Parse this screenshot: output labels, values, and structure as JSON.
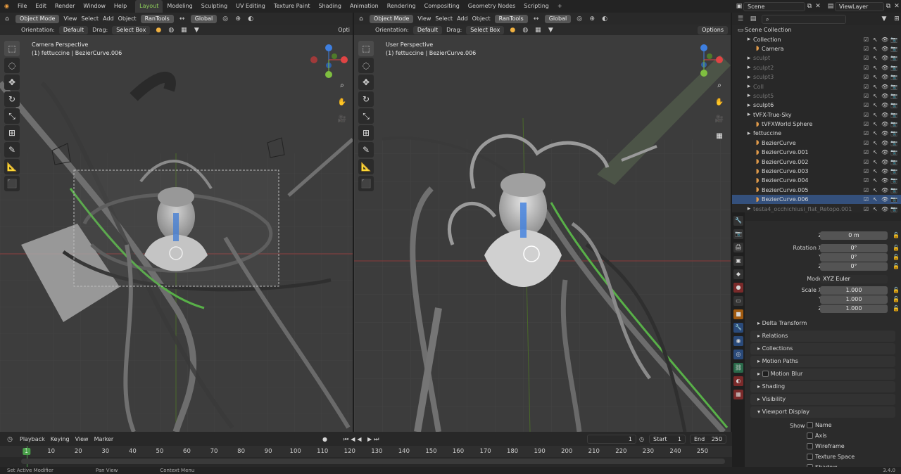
{
  "menu": [
    "File",
    "Edit",
    "Render",
    "Window",
    "Help"
  ],
  "workspaces": [
    {
      "label": "Layout",
      "active": true
    },
    {
      "label": "Modeling"
    },
    {
      "label": "Sculpting"
    },
    {
      "label": "UV Editing"
    },
    {
      "label": "Texture Paint"
    },
    {
      "label": "Shading"
    },
    {
      "label": "Animation"
    },
    {
      "label": "Rendering"
    },
    {
      "label": "Compositing"
    },
    {
      "label": "Geometry Nodes"
    },
    {
      "label": "Scripting"
    }
  ],
  "add_workspace": "+",
  "scene": "Scene",
  "view_layer": "ViewLayer",
  "left_view": {
    "mode": "Object Mode",
    "menus": [
      "View",
      "Select",
      "Add",
      "Object"
    ],
    "addon": "RanTools",
    "transform": "Global",
    "orientation_label": "Orientation:",
    "orientation": "Default",
    "drag_label": "Drag:",
    "drag": "Select Box",
    "options": "Opti",
    "perspective": "Camera Perspective",
    "object": "(1) fettuccine | BezierCurve.006"
  },
  "right_view": {
    "mode": "Object Mode",
    "menus": [
      "View",
      "Select",
      "Add",
      "Object"
    ],
    "addon": "RanTools",
    "transform": "Global",
    "orientation_label": "Orientation:",
    "orientation": "Default",
    "drag_label": "Drag:",
    "drag": "Select Box",
    "options": "Options",
    "perspective": "User Perspective",
    "object": "(1) fettuccine | BezierCurve.006"
  },
  "outliner": {
    "search_placeholder": "",
    "rows": [
      {
        "label": "Scene Collection",
        "indent": 0
      },
      {
        "label": "Collection",
        "indent": 1
      },
      {
        "label": "Camera",
        "indent": 2
      },
      {
        "label": "sculpt",
        "indent": 1,
        "dim": true
      },
      {
        "label": "sculpt2",
        "indent": 1,
        "dim": true
      },
      {
        "label": "sculpt3",
        "indent": 1,
        "dim": true
      },
      {
        "label": "Coll",
        "indent": 1,
        "dim": true
      },
      {
        "label": "sculpt5",
        "indent": 1,
        "dim": true
      },
      {
        "label": "sculpt6",
        "indent": 1
      },
      {
        "label": "tVFX-True-Sky",
        "indent": 1
      },
      {
        "label": "tVFXWorld Sphere",
        "indent": 2
      },
      {
        "label": "fettuccine",
        "indent": 1
      },
      {
        "label": "BezierCurve",
        "indent": 2
      },
      {
        "label": "BezierCurve.001",
        "indent": 2
      },
      {
        "label": "BezierCurve.002",
        "indent": 2
      },
      {
        "label": "BezierCurve.003",
        "indent": 2
      },
      {
        "label": "BezierCurve.004",
        "indent": 2
      },
      {
        "label": "BezierCurve.005",
        "indent": 2
      },
      {
        "label": "BezierCurve.006",
        "indent": 2,
        "selected": true
      },
      {
        "label": "testa4_occhichiusi_flat_Retopo.001",
        "indent": 1,
        "dim": true
      }
    ]
  },
  "properties": {
    "fields": [
      {
        "label": "Z",
        "value": "0 m"
      },
      {
        "label": "Rotation X",
        "value": "0°"
      },
      {
        "label": "Y",
        "value": "0°"
      },
      {
        "label": "Z",
        "value": "0°"
      },
      {
        "label": "Mode",
        "value": "XYZ Euler"
      },
      {
        "label": "Scale X",
        "value": "1.000"
      },
      {
        "label": "Y",
        "value": "1.000"
      },
      {
        "label": "Z",
        "value": "1.000"
      }
    ],
    "delta": "Delta Transform",
    "panels": [
      "Relations",
      "Collections",
      "Motion Paths",
      "Motion Blur",
      "Shading",
      "Visibility",
      "Viewport Display"
    ],
    "show_label": "Show",
    "show_items": [
      "Name",
      "Axis",
      "Wireframe",
      "Texture Space",
      "Shadow"
    ]
  },
  "timeline": {
    "menus": [
      "Playback",
      "Keying",
      "View",
      "Marker"
    ],
    "current_frame": "1",
    "start_label": "Start",
    "start": "1",
    "end_label": "End",
    "end": "250",
    "ticks": [
      "1",
      "10",
      "20",
      "30",
      "40",
      "50",
      "60",
      "70",
      "80",
      "90",
      "100",
      "110",
      "120",
      "130",
      "140",
      "150",
      "160",
      "170",
      "180",
      "190",
      "200",
      "210",
      "220",
      "230",
      "240",
      "250"
    ]
  },
  "status": [
    "Set Active Modifier",
    "Pan View",
    "Context Menu"
  ],
  "version": "3.4.0",
  "colors": {
    "accent": "#8fd05b",
    "selection": "#34507c",
    "x_axis": "#e04444",
    "y_axis": "#7fbf40",
    "z_axis": "#3e7fe0"
  }
}
